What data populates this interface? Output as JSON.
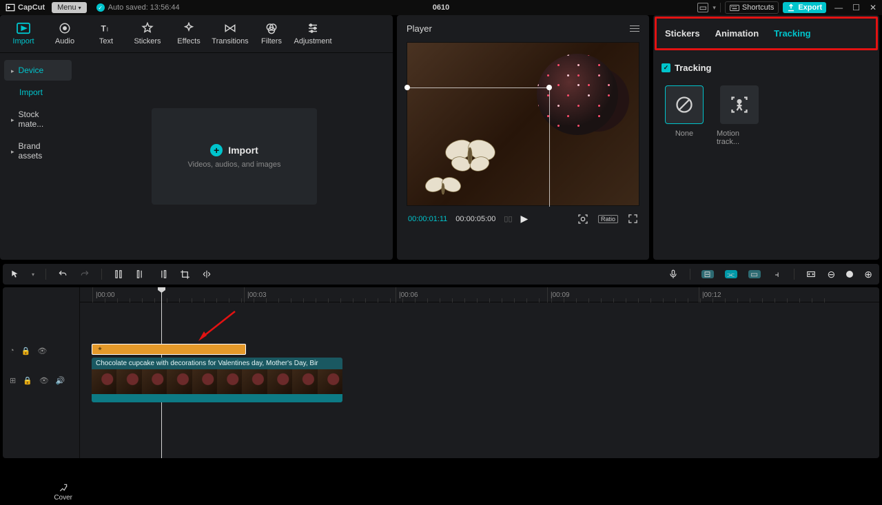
{
  "titlebar": {
    "app": "CapCut",
    "menu": "Menu",
    "autosave": "Auto saved: 13:56:44",
    "project": "0610",
    "shortcuts": "Shortcuts",
    "export": "Export"
  },
  "top_tabs": {
    "import": "Import",
    "audio": "Audio",
    "text": "Text",
    "stickers": "Stickers",
    "effects": "Effects",
    "transitions": "Transitions",
    "filters": "Filters",
    "adjustment": "Adjustment"
  },
  "left_side": {
    "device": "Device",
    "import": "Import",
    "stock": "Stock mate...",
    "brand": "Brand assets"
  },
  "import_box": {
    "title": "Import",
    "sub": "Videos, audios, and images"
  },
  "player": {
    "title": "Player",
    "tc_current": "00:00:01:11",
    "tc_total": "00:00:05:00",
    "ratio": "Ratio"
  },
  "right": {
    "tab_stickers": "Stickers",
    "tab_animation": "Animation",
    "tab_tracking": "Tracking",
    "tracking_hdr": "Tracking",
    "opt_none": "None",
    "opt_motion": "Motion track..."
  },
  "ruler": {
    "t0": "|00:00",
    "t1": "|00:03",
    "t2": "|00:06",
    "t3": "|00:09",
    "t4": "|00:12"
  },
  "clips": {
    "video_label": "Chocolate cupcake with decorations for Valentines day, Mother's Day, Bir",
    "cover": "Cover"
  }
}
